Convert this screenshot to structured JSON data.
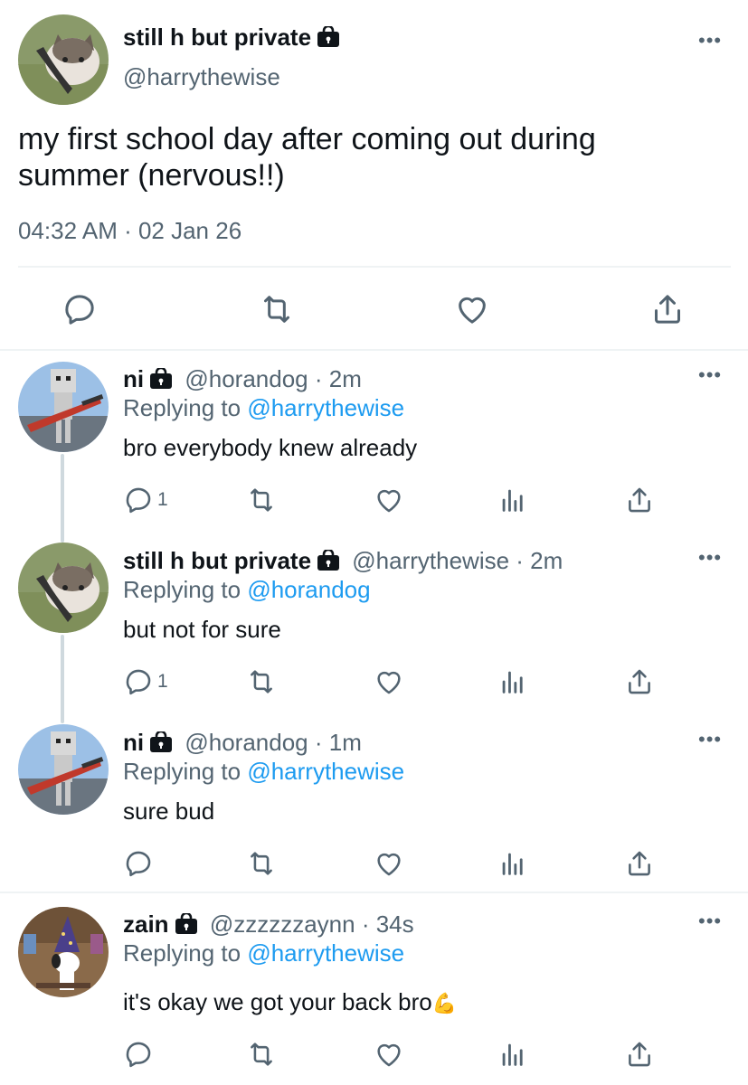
{
  "main_tweet": {
    "display_name": "still h but private",
    "handle": "@harrythewise",
    "text_line1": "my first school day after coming out during",
    "text_line2": "summer (nervous!!)",
    "timestamp": "04:32 AM · 02 Jan 26"
  },
  "replies": [
    {
      "display_name": "ni",
      "handle": "@horandog",
      "time": "· 2m",
      "replying_label": "Replying to",
      "replying_to": "@harrythewise",
      "text": "bro everybody knew already",
      "reply_count": "1"
    },
    {
      "display_name": "still h but private",
      "handle": "@harrythewise",
      "time": "· 2m",
      "replying_label": "Replying to",
      "replying_to": "@horandog",
      "text": "but not for sure",
      "reply_count": "1"
    },
    {
      "display_name": "ni",
      "handle": "@horandog",
      "time": "· 1m",
      "replying_label": "Replying to",
      "replying_to": "@harrythewise",
      "text": "sure bud",
      "reply_count": ""
    },
    {
      "display_name": "zain",
      "handle": "@zzzzzzaynn",
      "time": "· 34s",
      "replying_label": "Replying to",
      "replying_to": "@harrythewise",
      "text": "it's okay we got your back bro",
      "emoji": "💪",
      "reply_count": ""
    }
  ],
  "icons": {
    "reply": "reply-icon",
    "retweet": "retweet-icon",
    "like": "heart-icon",
    "views": "views-icon",
    "share": "share-icon",
    "lock": "lock-icon",
    "more": "more-icon"
  },
  "colors": {
    "link": "#1d9bf0",
    "muted": "#536471",
    "text": "#0f1419"
  }
}
